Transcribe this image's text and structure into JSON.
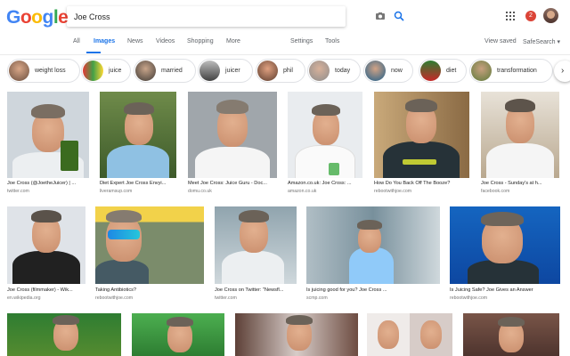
{
  "logo": [
    "G",
    "o",
    "o",
    "g",
    "l",
    "e"
  ],
  "search": {
    "query": "Joe Cross"
  },
  "header": {
    "notification_count": "2"
  },
  "nav": {
    "tabs": [
      "All",
      "Images",
      "News",
      "Videos",
      "Shopping",
      "More"
    ],
    "right": [
      "Settings",
      "Tools"
    ],
    "view_saved": "View saved",
    "safesearch": "SafeSearch ▾"
  },
  "chips": [
    {
      "label": "weight loss"
    },
    {
      "label": "juice"
    },
    {
      "label": "married"
    },
    {
      "label": "juicer"
    },
    {
      "label": "phil"
    },
    {
      "label": "today"
    },
    {
      "label": "now"
    },
    {
      "label": "diet"
    },
    {
      "label": "transformation"
    }
  ],
  "results": [
    {
      "caption": "Joe Cross (@JoetheJuicer) | ...",
      "source": "twitter.com"
    },
    {
      "caption": "Diet Expert Joe Cross Envyi...",
      "source": "liveramsup.com"
    },
    {
      "caption": "Meet Joe Cross: Juice Guru - Doc...",
      "source": "domu.co.uk"
    },
    {
      "caption": "Amazon.co.uk: Joe Cross: ...",
      "source": "amazon.co.uk"
    },
    {
      "caption": "How Do You Back Off The Booze?",
      "source": "rebootwithjoe.com"
    },
    {
      "caption": "Joe Cross - Sunday's at h...",
      "source": "facebook.com"
    },
    {
      "caption": "Joe Cross (filmmaker) - Wik...",
      "source": "en.wikipedia.org"
    },
    {
      "caption": "Taking Antibiotics?",
      "source": "rebootwithjoe.com"
    },
    {
      "caption": "Joe Cross on Twitter: \"Newsfl...",
      "source": "twitter.com"
    },
    {
      "caption": "Is juicing good for you? Joe Cross ...",
      "source": "scmp.com"
    },
    {
      "caption": "Is Juicing Safe? Joe Gives an Answer",
      "source": "rebootwithjoe.com"
    }
  ],
  "colors": {
    "accent": "#1a73e8",
    "notif": "#db4437"
  }
}
